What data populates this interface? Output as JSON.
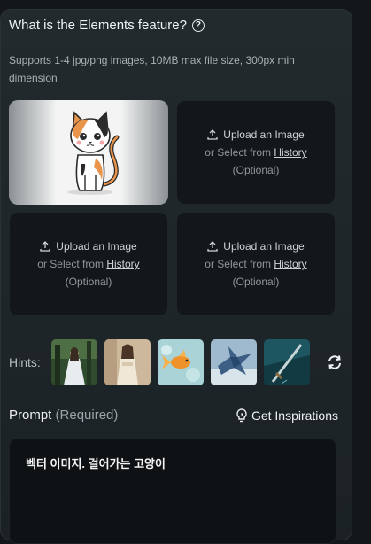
{
  "header": {
    "title": "What is the Elements feature?",
    "subtitle": "Supports 1-4 jpg/png images, 10MB max file size, 300px min dimension"
  },
  "upload_slot": {
    "upload_label": "Upload an Image",
    "or_select_prefix": "or Select from",
    "history_link": "History",
    "optional_label": "(Optional)"
  },
  "slots": [
    {
      "state": "filled",
      "image": "calico-cat-illustration"
    },
    {
      "state": "empty"
    },
    {
      "state": "empty"
    },
    {
      "state": "empty"
    }
  ],
  "hints": {
    "label": "Hints:",
    "thumbnails": [
      "woman-in-forest",
      "woman-in-cream-dress",
      "goldfish",
      "blue-dragon",
      "sword-in-water"
    ]
  },
  "prompt": {
    "label": "Prompt",
    "required_label": "(Required)",
    "inspirations_button": "Get Inspirations",
    "value": "벡터 이미지. 걸어가는 고양이"
  },
  "colors": {
    "panel_bg": "#1e2528",
    "slot_bg": "#141719",
    "accent_text": "#eef0f1"
  }
}
